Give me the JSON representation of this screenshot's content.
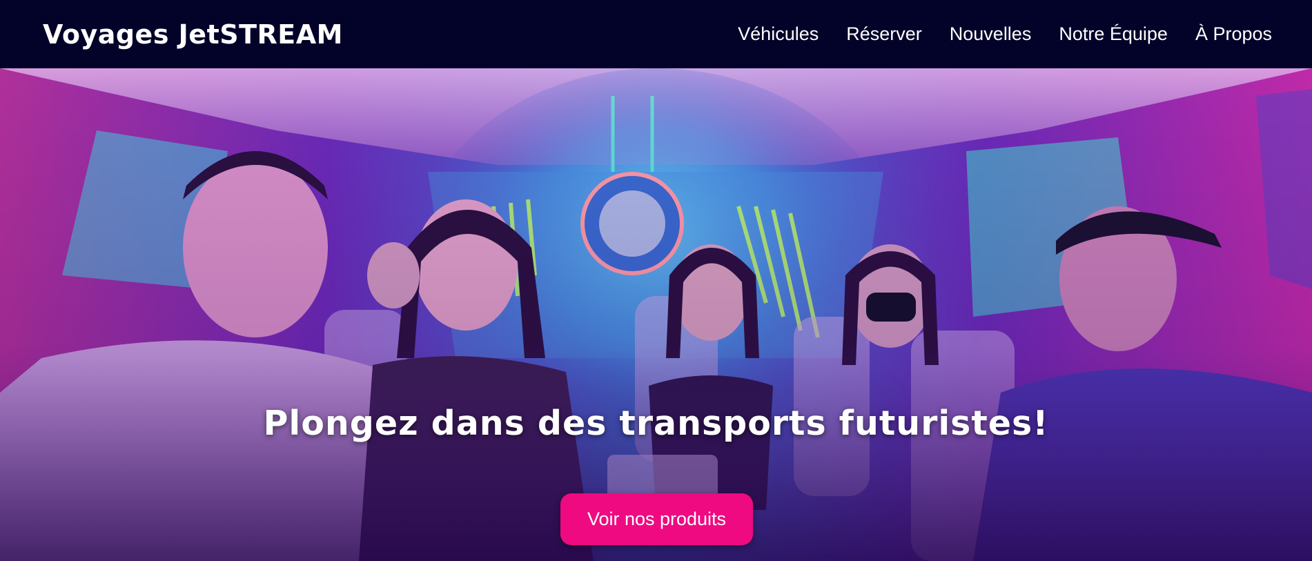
{
  "header": {
    "brand": "Voyages JetSTREAM",
    "nav": [
      {
        "label": "Véhicules"
      },
      {
        "label": "Réserver"
      },
      {
        "label": "Nouvelles"
      },
      {
        "label": "Notre Équipe"
      },
      {
        "label": "À Propos"
      }
    ]
  },
  "hero": {
    "title": "Plongez dans des transports futuristes!",
    "cta_label": "Voir nos produits",
    "image_subject": "passengers seated inside a neon-lit futuristic vehicle cabin"
  },
  "colors": {
    "navbar_bg": "#03032a",
    "accent": "#ef0a82",
    "text": "#ffffff",
    "hero_neon_pink": "#e040c8",
    "hero_neon_cyan": "#40e0e0",
    "hero_purple": "#7a30c8"
  }
}
